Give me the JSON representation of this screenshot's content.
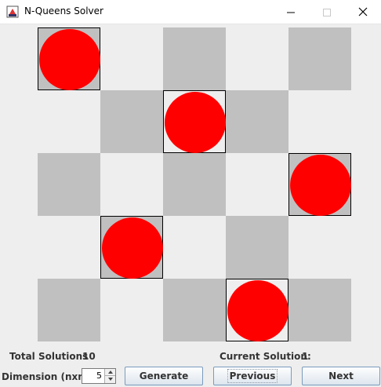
{
  "window": {
    "title": "N-Queens Solver",
    "icon": "java-coffee-icon",
    "controls": [
      "minimize-icon",
      "maximize-icon",
      "close-icon"
    ]
  },
  "board": {
    "size": 5,
    "queens": [
      {
        "row": 0,
        "col": 0
      },
      {
        "row": 1,
        "col": 2
      },
      {
        "row": 2,
        "col": 4
      },
      {
        "row": 3,
        "col": 1
      },
      {
        "row": 4,
        "col": 3
      }
    ],
    "colors": {
      "dark": "#c0c0c0",
      "light": "#eeeeee",
      "queen": "#ff0000"
    }
  },
  "stats": {
    "total_label": "Total Solutions",
    "total_value": "10",
    "current_label": "Current Solution:",
    "current_value": "1"
  },
  "controls": {
    "dimension_label": "Dimension (nxn)",
    "dimension_value": "5",
    "generate_label": "Generate",
    "previous_label": "Previous",
    "next_label": "Next"
  }
}
